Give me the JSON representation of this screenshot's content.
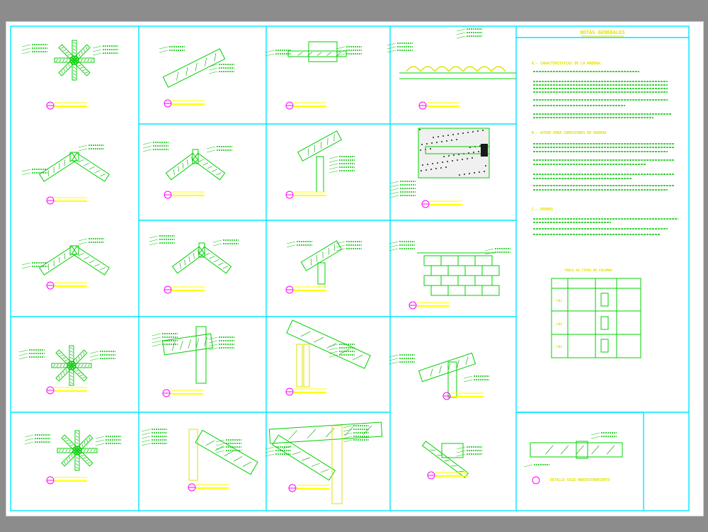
{
  "sheet": {
    "notes_title": "NOTAS GENERALES",
    "notes_section_1": "A.- CARACTERISTICAS DE LA MADERA:",
    "notes_section_2": "B.- ACERO PARA CONEXIONES DE MADERA",
    "notes_section_3": "C.- PERNOS",
    "notes_table_title": "TABLA DE TIPOS DE COLUMNA",
    "notes_table_rows": [
      "C01",
      "C02",
      "C03"
    ],
    "bottom_detail_title": "DETALLE VIGA ARRIOSTRAMIENTO"
  },
  "colors": {
    "background": "#8c8c8c",
    "sheet": "#ffffff",
    "grid_lines": "#00e5ff",
    "linework": "#00d000",
    "titles": "#e0e000",
    "markers": "#ff00ff"
  }
}
